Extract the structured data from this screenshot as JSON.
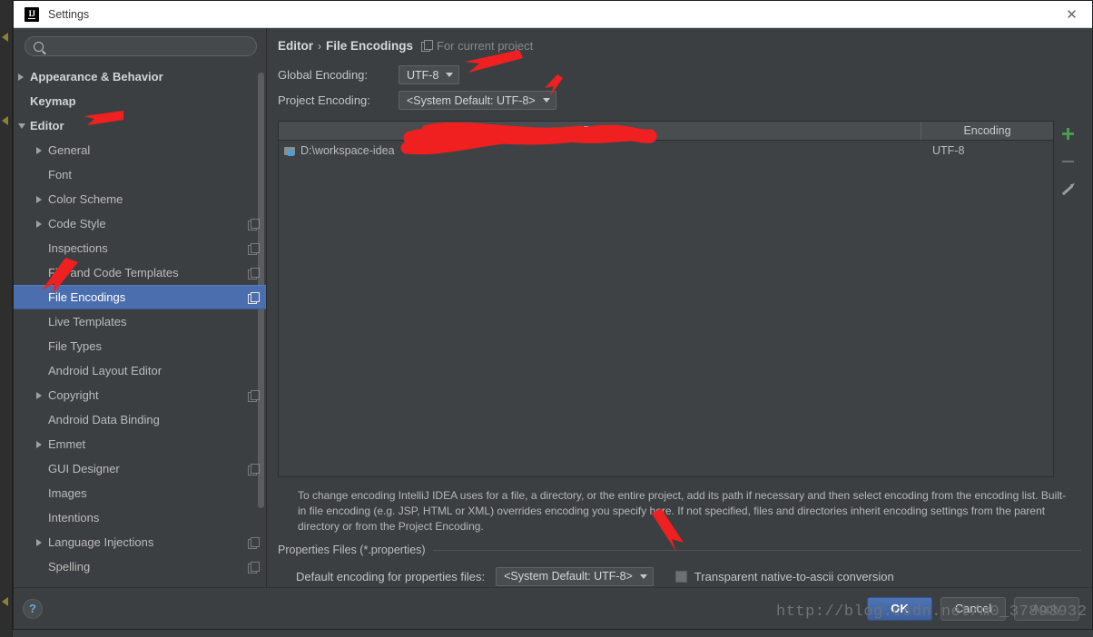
{
  "window": {
    "title": "Settings",
    "logo": "intellij-idea-logo",
    "close_label": "✕"
  },
  "sidebar": {
    "search": {
      "value": "",
      "placeholder": "",
      "icon": "search-icon"
    },
    "items": [
      {
        "label": "Appearance & Behavior",
        "level": 0,
        "twisty": "closed",
        "bold": true,
        "selected": false,
        "badge": false
      },
      {
        "label": "Keymap",
        "level": 0,
        "twisty": "none",
        "bold": true,
        "selected": false,
        "badge": false
      },
      {
        "label": "Editor",
        "level": 0,
        "twisty": "open",
        "bold": true,
        "selected": false,
        "badge": false
      },
      {
        "label": "General",
        "level": 1,
        "twisty": "closed",
        "bold": false,
        "selected": false,
        "badge": false
      },
      {
        "label": "Font",
        "level": 1,
        "twisty": "none",
        "bold": false,
        "selected": false,
        "badge": false
      },
      {
        "label": "Color Scheme",
        "level": 1,
        "twisty": "closed",
        "bold": false,
        "selected": false,
        "badge": false
      },
      {
        "label": "Code Style",
        "level": 1,
        "twisty": "closed",
        "bold": false,
        "selected": false,
        "badge": true
      },
      {
        "label": "Inspections",
        "level": 1,
        "twisty": "none",
        "bold": false,
        "selected": false,
        "badge": true
      },
      {
        "label": "File and Code Templates",
        "level": 1,
        "twisty": "none",
        "bold": false,
        "selected": false,
        "badge": true
      },
      {
        "label": "File Encodings",
        "level": 1,
        "twisty": "none",
        "bold": false,
        "selected": true,
        "badge": true
      },
      {
        "label": "Live Templates",
        "level": 1,
        "twisty": "none",
        "bold": false,
        "selected": false,
        "badge": false
      },
      {
        "label": "File Types",
        "level": 1,
        "twisty": "none",
        "bold": false,
        "selected": false,
        "badge": false
      },
      {
        "label": "Android Layout Editor",
        "level": 1,
        "twisty": "none",
        "bold": false,
        "selected": false,
        "badge": false
      },
      {
        "label": "Copyright",
        "level": 1,
        "twisty": "closed",
        "bold": false,
        "selected": false,
        "badge": true
      },
      {
        "label": "Android Data Binding",
        "level": 1,
        "twisty": "none",
        "bold": false,
        "selected": false,
        "badge": false
      },
      {
        "label": "Emmet",
        "level": 1,
        "twisty": "closed",
        "bold": false,
        "selected": false,
        "badge": false
      },
      {
        "label": "GUI Designer",
        "level": 1,
        "twisty": "none",
        "bold": false,
        "selected": false,
        "badge": true
      },
      {
        "label": "Images",
        "level": 1,
        "twisty": "none",
        "bold": false,
        "selected": false,
        "badge": false
      },
      {
        "label": "Intentions",
        "level": 1,
        "twisty": "none",
        "bold": false,
        "selected": false,
        "badge": false
      },
      {
        "label": "Language Injections",
        "level": 1,
        "twisty": "closed",
        "bold": false,
        "selected": false,
        "badge": true
      },
      {
        "label": "Spelling",
        "level": 1,
        "twisty": "none",
        "bold": false,
        "selected": false,
        "badge": true
      }
    ]
  },
  "content": {
    "breadcrumb": {
      "root": "Editor",
      "separator": "›",
      "leaf": "File Encodings",
      "scope_icon": "project-scope-icon",
      "scope_note": "For current project"
    },
    "global_encoding": {
      "label": "Global Encoding:",
      "value": "UTF-8"
    },
    "project_encoding": {
      "label": "Project Encoding:",
      "value": "<System Default: UTF-8>"
    },
    "table": {
      "columns": [
        "Path",
        "Encoding"
      ],
      "sort_column": "Path",
      "sort_direction": "ascending",
      "rows": [
        {
          "icon": "folder-module-icon",
          "path": "D:\\workspace-idea",
          "path_redacted": true,
          "encoding": "UTF-8"
        }
      ],
      "side_buttons": [
        {
          "name": "add-path-button",
          "icon": "plus-icon",
          "label": "+"
        },
        {
          "name": "remove-path-button",
          "icon": "minus-icon",
          "label": "−"
        },
        {
          "name": "edit-path-button",
          "icon": "pencil-icon",
          "label": "✎"
        }
      ]
    },
    "description": "To change encoding IntelliJ IDEA uses for a file, a directory, or the entire project, add its path if necessary and then select encoding from the encoding list. Built-in file encoding (e.g. JSP, HTML or XML) overrides encoding you specify here. If not specified, files and directories inherit encoding settings from the parent directory or from the Project Encoding.",
    "properties_group": {
      "legend": "Properties Files (*.properties)",
      "default_encoding_label": "Default encoding for properties files:",
      "default_encoding_value": "<System Default: UTF-8>",
      "transparent_checkbox_label": "Transparent native-to-ascii conversion",
      "transparent_checked": false
    }
  },
  "footer": {
    "help_label": "?",
    "ok_label": "OK",
    "cancel_label": "Cancel",
    "apply_label": "Apply",
    "apply_disabled": true
  },
  "watermark": "http://blog.csdn.net/m0_37893932",
  "colors": {
    "dialog_bg": "#3c3f41",
    "titlebar_bg": "#ffffff",
    "selection_blue": "#4b6eaf",
    "accent_green": "#4a9b4a",
    "annotation_red": "#f02020",
    "primary_button": "#4f74b5"
  }
}
